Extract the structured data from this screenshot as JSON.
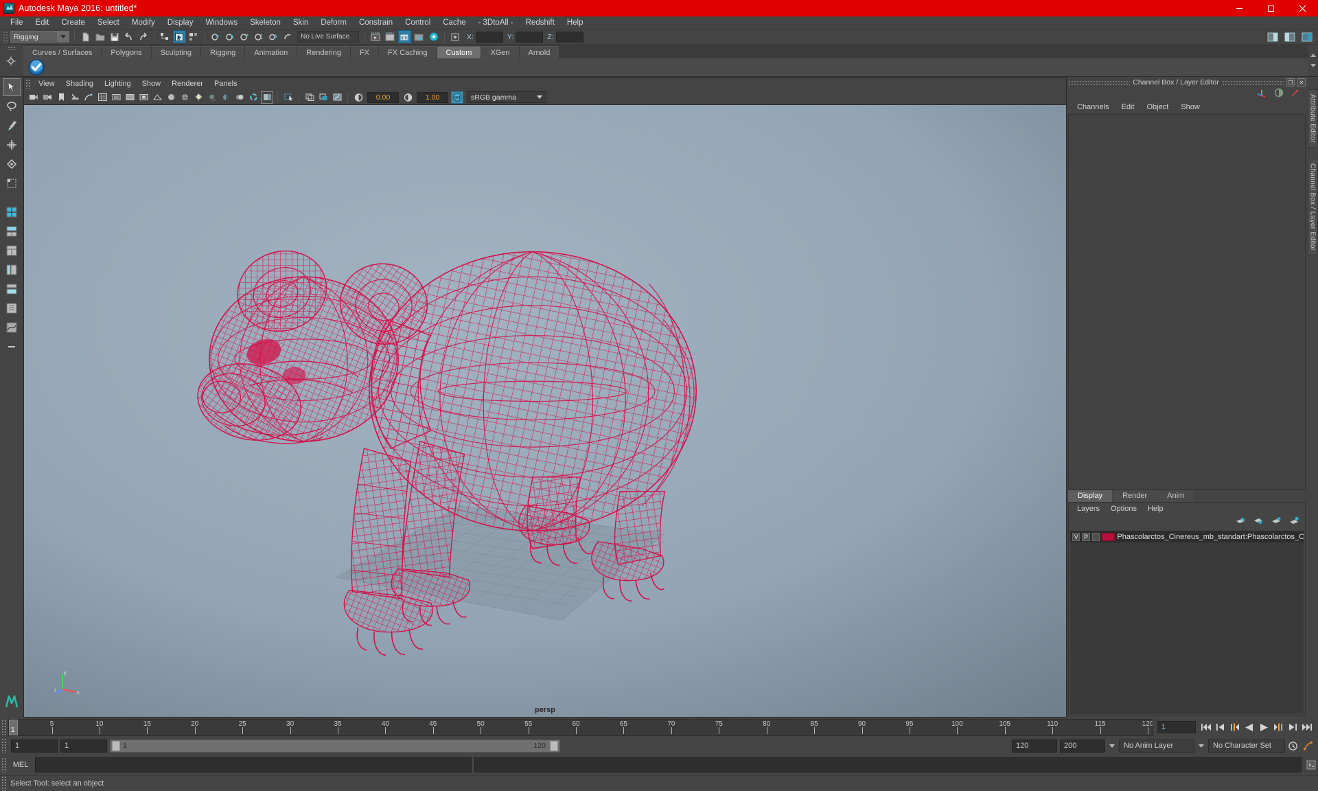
{
  "window": {
    "title": "Autodesk Maya 2016: untitled*",
    "minimize": "—",
    "maximize": "❐",
    "close": "✕"
  },
  "menubar": {
    "items": [
      {
        "label": "File"
      },
      {
        "label": "Edit"
      },
      {
        "label": "Create"
      },
      {
        "label": "Select"
      },
      {
        "label": "Modify"
      },
      {
        "label": "Display"
      },
      {
        "label": "Windows"
      },
      {
        "label": "Skeleton"
      },
      {
        "label": "Skin"
      },
      {
        "label": "Deform"
      },
      {
        "label": "Constrain"
      },
      {
        "label": "Control"
      },
      {
        "label": "Cache"
      },
      {
        "label": "- 3DtoAll -"
      },
      {
        "label": "Redshift"
      },
      {
        "label": "Help"
      }
    ]
  },
  "statusbar": {
    "menuset": "Rigging",
    "live_surface": "No Live Surface",
    "coord_x_label": "X:",
    "coord_y_label": "Y:",
    "coord_z_label": "Z:",
    "coord_x_value": "",
    "coord_y_value": "",
    "coord_z_value": ""
  },
  "shelf": {
    "tabs": [
      {
        "label": "Curves / Surfaces",
        "active": false
      },
      {
        "label": "Polygons",
        "active": false
      },
      {
        "label": "Sculpting",
        "active": false
      },
      {
        "label": "Rigging",
        "active": false
      },
      {
        "label": "Animation",
        "active": false
      },
      {
        "label": "Rendering",
        "active": false
      },
      {
        "label": "FX",
        "active": false
      },
      {
        "label": "FX Caching",
        "active": false
      },
      {
        "label": "Custom",
        "active": true
      },
      {
        "label": "XGen",
        "active": false
      },
      {
        "label": "Arnold",
        "active": false
      }
    ]
  },
  "viewport": {
    "menus": [
      {
        "label": "View"
      },
      {
        "label": "Shading"
      },
      {
        "label": "Lighting"
      },
      {
        "label": "Show"
      },
      {
        "label": "Renderer"
      },
      {
        "label": "Panels"
      }
    ],
    "exposure_value": "0.00",
    "gamma_value": "1.00",
    "color_toggle": "ON",
    "color_profile": "sRGB gamma",
    "camera_label": "persp",
    "axis_x": "x",
    "axis_y": "y",
    "axis_z": "z",
    "model_color": "#d4104a"
  },
  "right_panel": {
    "title": "Channel Box / Layer Editor",
    "restore_glyph": "❐",
    "close_glyph": "✕",
    "menus": [
      {
        "label": "Channels"
      },
      {
        "label": "Edit"
      },
      {
        "label": "Object"
      },
      {
        "label": "Show"
      }
    ],
    "vertical_tabs": [
      {
        "label": "Attribute Editor"
      },
      {
        "label": "Channel Box / Layer Editor"
      }
    ],
    "layer_editor": {
      "tabs": [
        {
          "label": "Display",
          "active": true
        },
        {
          "label": "Render",
          "active": false
        },
        {
          "label": "Anim",
          "active": false
        }
      ],
      "menus": [
        {
          "label": "Layers"
        },
        {
          "label": "Options"
        },
        {
          "label": "Help"
        }
      ],
      "rows": [
        {
          "visibility": "V",
          "playback": "P",
          "state": "",
          "color": "#b4123b",
          "name": "Phascolarctos_Cinereus_mb_standart:Phascolarctos_Cine"
        }
      ]
    }
  },
  "timeline": {
    "start": 1,
    "end": 120,
    "current_frame": "1",
    "ticks": [
      5,
      10,
      15,
      20,
      25,
      30,
      35,
      40,
      45,
      50,
      55,
      60,
      65,
      70,
      75,
      80,
      85,
      90,
      95,
      100,
      105,
      110,
      115,
      120
    ],
    "cursor_label": "1",
    "playback_buttons": [
      {
        "name": "go-to-start"
      },
      {
        "name": "step-back-keyframe"
      },
      {
        "name": "step-back-frame"
      },
      {
        "name": "play-backwards"
      },
      {
        "name": "play-forwards"
      },
      {
        "name": "step-forward-frame"
      },
      {
        "name": "step-forward-keyframe"
      },
      {
        "name": "go-to-end"
      }
    ]
  },
  "range_bar": {
    "anim_start": "1",
    "range_start": "1",
    "slider_left_label": "1",
    "slider_right_label": "120",
    "range_end": "120",
    "anim_end": "200",
    "anim_layer": "No Anim Layer",
    "character_set": "No Character Set"
  },
  "command_line": {
    "language": "MEL",
    "input_value": "",
    "output_value": ""
  },
  "help_line": {
    "text": "Select Tool: select an object"
  }
}
